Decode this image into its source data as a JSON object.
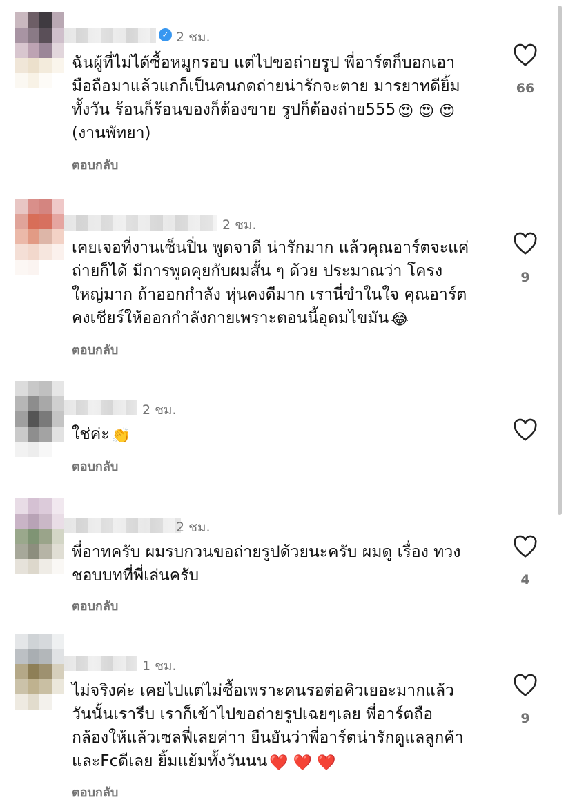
{
  "comments": [
    {
      "time": "2 ชม.",
      "verified": true,
      "lines": [
        "ฉันผู้ที่ไม่ได้ซื้อหมูกรอบ แต่ไปขอถ่ายรูป พี่อาร์ตก็บอกเอา",
        "มือถือมาแล้วแกก็เป็นคนกดถ่ายน่ารักจะตาย มารยาทดียิ้ม",
        "ทั้งวัน ร้อนก็ร้อนของก็ต้องขาย รูปก็ต้องถ่าย555",
        "(งานพัทยา)"
      ],
      "line3_emoji": "😍 😍 😍",
      "reply_label": "ตอบกลับ",
      "likes": "66"
    },
    {
      "time": "2 ชม.",
      "verified": false,
      "lines": [
        "เคยเจอที่งานเซ็นปิ่น พูดจาดี น่ารักมาก แล้วคุณอาร์ตจะแค่",
        "ถ่ายก็ได้ มีการพูดคุยกับผมสั้น ๆ ด้วย ประมาณว่า โครง",
        "ใหญ่มาก ถ้าออกกำลัง หุ่นคงดีมาก เรานี่ขำในใจ คุณอาร์ต",
        "คงเชียร์ให้ออกกำลังกายเพราะตอนนี้อุดมไขมัน"
      ],
      "line4_emoji": "😂",
      "reply_label": "ตอบกลับ",
      "likes": "9"
    },
    {
      "time": "2 ชม.",
      "verified": false,
      "lines": [
        "ใช่ค่ะ"
      ],
      "line1_emoji": "👏",
      "reply_label": "ตอบกลับ",
      "likes": ""
    },
    {
      "time": "2 ชม.",
      "verified": false,
      "lines": [
        "พี่อาทครับ ผมรบกวนขอถ่ายรูปด้วยนะครับ ผมดู เรื่อง ทวง",
        "ชอบบทที่พี่เล่นครับ"
      ],
      "reply_label": "ตอบกลับ",
      "likes": "4"
    },
    {
      "time": "1 ชม.",
      "verified": false,
      "lines": [
        "ไม่จริงค่ะ เคยไปแต่ไม่ซื้อเพราะคนรอต่อคิวเยอะมากแล้ว",
        "วันนั้นเรารีบ เราก็เข้าไปขอถ่ายรูปเฉยๆเลย พี่อาร์ตถือ",
        "กล้องให้แล้วเซลฟี่เลยค่าา ยืนยันว่าพี่อาร์ตน่ารักดูแลลูกค้า",
        "และFcดีเลย ยิ้มแย้มทั้งวันนน"
      ],
      "line4_emoji": "❤️ ❤️ ❤️",
      "reply_label": "ตอบกลับ",
      "likes": "9"
    }
  ],
  "icons": {
    "like": "heart-outline-icon",
    "verified": "verified-badge-icon"
  },
  "colors": {
    "verified": "#3897f0",
    "muted": "#737373"
  }
}
